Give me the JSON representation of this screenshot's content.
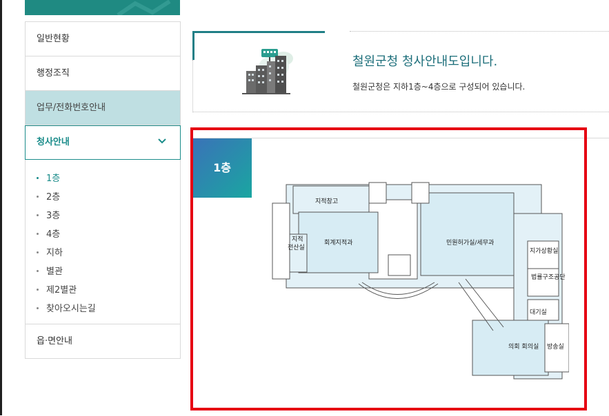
{
  "sidebar": {
    "items": [
      {
        "label": "일반현황"
      },
      {
        "label": "행정조직"
      },
      {
        "label": "업무/전화번호안내"
      },
      {
        "label": "청사안내"
      },
      {
        "label": "읍·면안내"
      }
    ],
    "sub_items": [
      {
        "label": "1층"
      },
      {
        "label": "2층"
      },
      {
        "label": "3층"
      },
      {
        "label": "4층"
      },
      {
        "label": "지하"
      },
      {
        "label": "별관"
      },
      {
        "label": "제2별관"
      },
      {
        "label": "찾아오시는길"
      }
    ]
  },
  "header": {
    "title": "철원군청 청사안내도입니다.",
    "description": "철원군청은 지하1층~4층으로 구성되어 있습니다."
  },
  "floor": {
    "tab_label": "1층",
    "rooms": {
      "r1": "지적창고",
      "r2": "회계지적과",
      "r3a": "지적",
      "r3b": "전산실",
      "r4": "민원허가실/세무과",
      "r5": "지가상황실",
      "r6": "법률구조공단",
      "r7": "대기실",
      "r8": "의회 회의실",
      "r9": "방송실"
    }
  },
  "colors": {
    "accent": "#1a8c8a",
    "highlight_border": "#e60012",
    "room_fill": "#e3f1f7"
  }
}
